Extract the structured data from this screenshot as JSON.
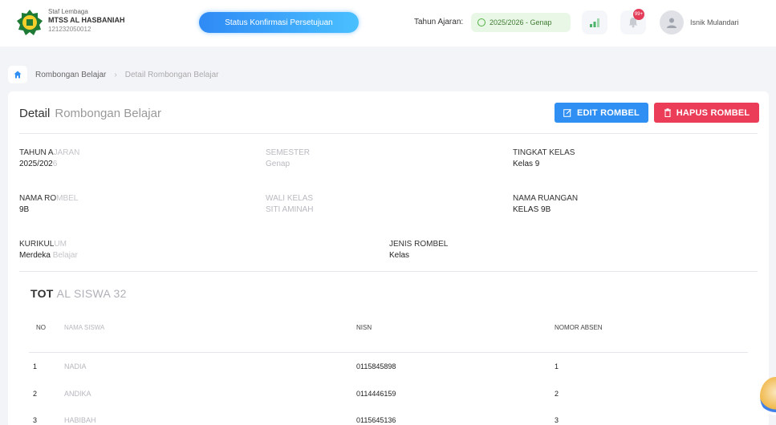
{
  "header": {
    "org_line1": "Staf Lembaga",
    "org_name": "MTSS AL HASBANIAH",
    "org_code": "121232050012",
    "status_button": "Status Konfirmasi Persetujuan",
    "tahun_label": "Tahun Ajaran:",
    "tahun_value": "2025/2026 - Genap",
    "notification_count": "99+",
    "username": "Isnik Mulandari"
  },
  "breadcrumb": {
    "item1": "Rombongan Belajar",
    "separator": "›",
    "item2": "Detail Rombongan Belajar"
  },
  "card": {
    "title": "Detail",
    "title_rest": "Rombongan Belajar",
    "edit_label": "EDIT ROMBEL",
    "hapus_label": "HAPUS ROMBEL",
    "fields": {
      "tahun_ajaran_key": "TAHUN A",
      "tahun_ajaran_key_rest": "JARAN",
      "tahun_ajaran_val": "2025/202",
      "tahun_ajaran_val_rest": "6",
      "semester_key": "SEMESTER",
      "semester_val": "Genap",
      "tingkat_key": "TINGKAT KELAS",
      "tingkat_val": "Kelas 9",
      "nama_rombel_key": "NAMA RO",
      "nama_rombel_key_rest": "MBEL",
      "nama_rombel_val": "9B",
      "wali_key": "WALI KELAS",
      "wali_val": "SITI AMINAH",
      "ruangan_key": "NAMA RUANGAN",
      "ruangan_val": "KELAS 9B",
      "kurikulum_key": "KURIKUL",
      "kurikulum_key_rest": "UM",
      "kurikulum_val": "Merdeka",
      "kurikulum_val_rest": "Belajar",
      "jenis_key": "JENIS ROMBEL",
      "jenis_val": "Kelas"
    },
    "total_label": "TOT",
    "total_rest": "AL SISWA 32",
    "table": {
      "headers": [
        "NO",
        "NAMA SISWA",
        "NISN",
        "NOMOR ABSEN"
      ],
      "rows": [
        {
          "no": "1",
          "nama": "NADIA",
          "nisn": "0115845898",
          "absen": "1"
        },
        {
          "no": "2",
          "nama": "ANDIKA",
          "nisn": "0114446159",
          "absen": "2"
        },
        {
          "no": "3",
          "nama": "HABIBAH",
          "nisn": "0115645136",
          "absen": "3"
        }
      ]
    }
  }
}
